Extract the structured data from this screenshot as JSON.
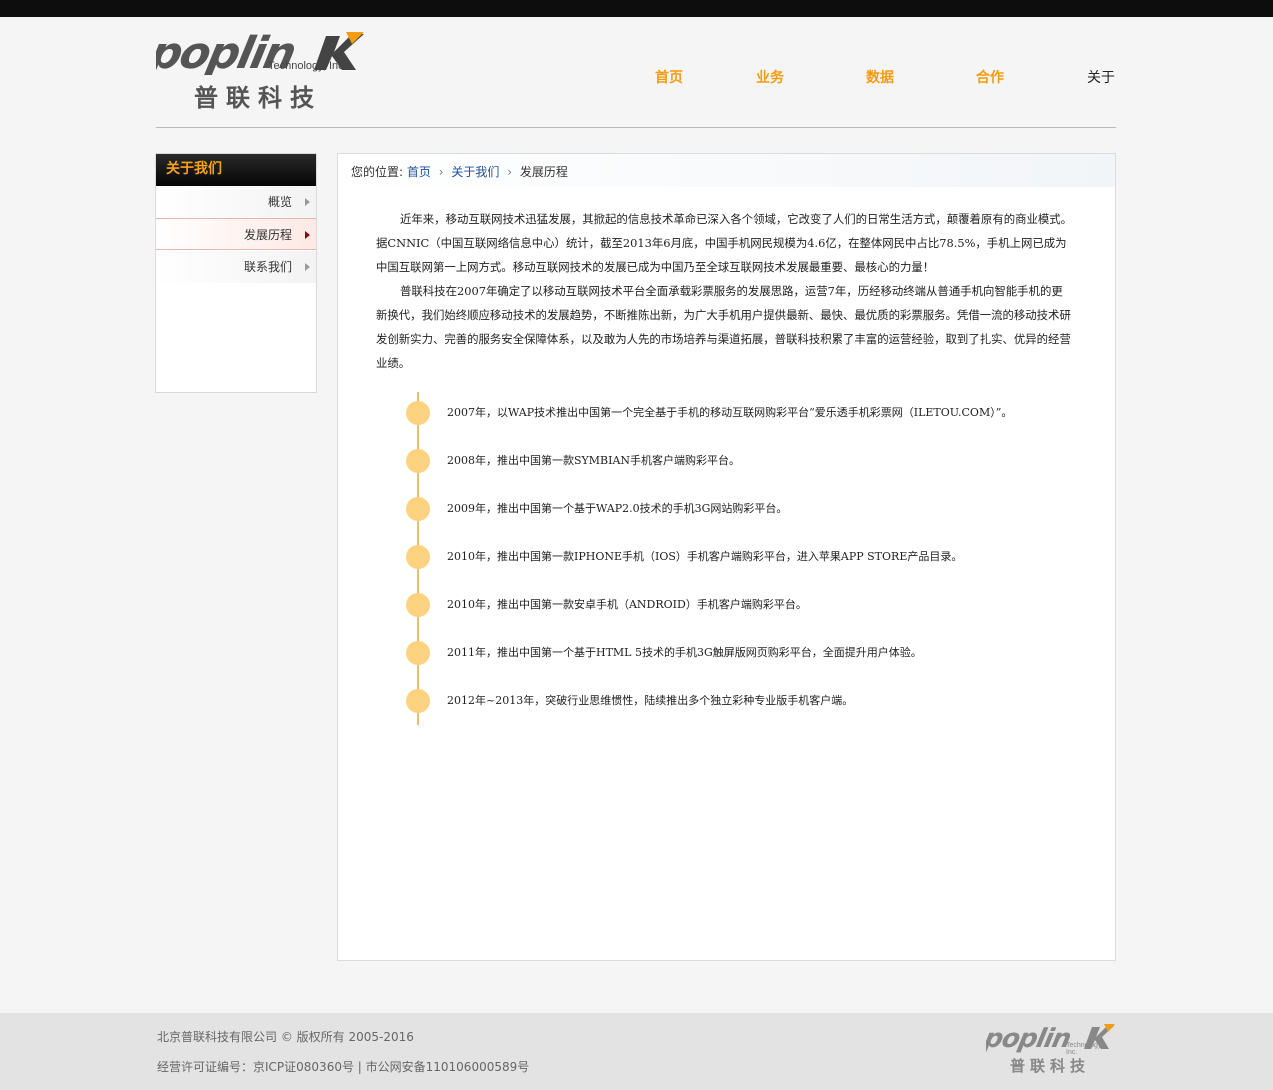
{
  "brand": {
    "logo_word": "poplink",
    "logo_tech": "Technology, Inc.",
    "logo_cn": "普联科技"
  },
  "nav": {
    "items": [
      "首页",
      "业务",
      "数据",
      "合作",
      "关于"
    ],
    "active": "关于"
  },
  "sidebar": {
    "title": "关于我们",
    "items": [
      "概览",
      "发展历程",
      "联系我们"
    ],
    "active": "发展历程"
  },
  "breadcrumb": {
    "prefix": "您的位置:",
    "home": "首页",
    "section": "关于我们",
    "current": "发展历程"
  },
  "content": {
    "paragraphs": [
      "近年来，移动互联网技术迅猛发展，其掀起的信息技术革命已深入各个领域，它改变了人们的日常生活方式，颠覆着原有的商业模式。据CNNIC（中国互联网络信息中心）统计，截至2013年6月底，中国手机网民规模为4.6亿，在整体网民中占比78.5%，手机上网已成为中国互联网第一上网方式。移动互联网技术的发展已成为中国乃至全球互联网技术发展最重要、最核心的力量！",
      "普联科技在2007年确定了以移动互联网技术平台全面承载彩票服务的发展思路，运营7年，历经移动终端从普通手机向智能手机的更新换代，我们始终顺应移动技术的发展趋势，不断推陈出新，为广大手机用户提供最新、最快、最优质的彩票服务。凭借一流的移动技术研发创新实力、完善的服务安全保障体系，以及敢为人先的市场培养与渠道拓展，普联科技积累了丰富的运营经验，取到了扎实、优异的经营业绩。"
    ],
    "timeline": [
      "2007年，以WAP技术推出中国第一个完全基于手机的移动互联网购彩平台“爱乐透手机彩票网（ILETOU.COM）”。",
      "2008年，推出中国第一款SYMBIAN手机客户端购彩平台。",
      "2009年，推出中国第一个基于WAP2.0技术的手机3G网站购彩平台。",
      "2010年，推出中国第一款IPHONE手机（IOS）手机客户端购彩平台，进入苹果APP STORE产品目录。",
      "2010年，推出中国第一款安卓手机（ANDROID）手机客户端购彩平台。",
      "2011年，推出中国第一个基于HTML 5技术的手机3G触屏版网页购彩平台，全面提升用户体验。",
      "2012年~2013年，突破行业思维惯性，陆续推出多个独立彩种专业版手机客户端。"
    ]
  },
  "footer": {
    "copyright": "北京普联科技有限公司 © 版权所有 2005-2016",
    "license": "经营许可证编号：京ICP证080360号 | 市公网安备110106000589号"
  },
  "colors": {
    "accent": "#f39c12",
    "topbar": "#0d0d0d",
    "timeline_dot": "#fdd280",
    "link": "#1d4f9c"
  }
}
